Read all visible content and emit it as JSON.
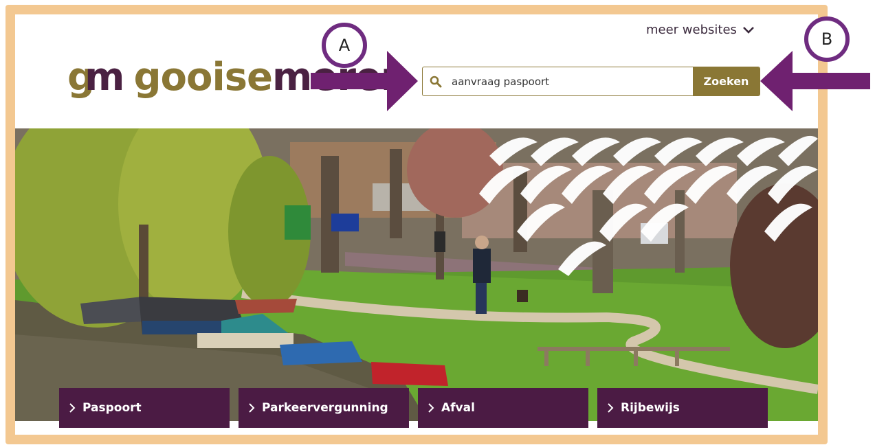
{
  "header": {
    "more_websites_label": "meer websites",
    "logo": {
      "gm_g": "g",
      "gm_m": "m",
      "word_part1": "gooise",
      "word_part2": "meren"
    }
  },
  "search": {
    "value": "aanvraag paspoort",
    "button_label": "Zoeken"
  },
  "quick_links": [
    {
      "label": "Paspoort"
    },
    {
      "label": "Parkeervergunning"
    },
    {
      "label": "Afval"
    },
    {
      "label": "Rijbewijs"
    }
  ],
  "annotations": {
    "marker_a": "A",
    "marker_b": "B",
    "arrow_color": "#6f2170"
  },
  "colors": {
    "frame": "#f3c891",
    "brand_gold": "#8a7735",
    "brand_purple": "#4b1b44"
  }
}
